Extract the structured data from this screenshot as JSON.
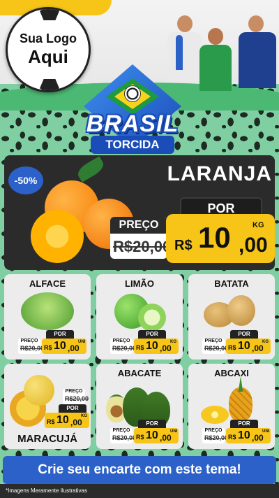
{
  "logo": {
    "line1": "Sua Logo",
    "line2": "Aqui"
  },
  "badge": {
    "title": "BRASIL",
    "subtitle": "TORCIDA"
  },
  "featured": {
    "name": "LARANJA",
    "discount": "-50%",
    "por_label": "POR",
    "preco_label": "PREÇO",
    "old_price": "R$20,00",
    "currency": "R$",
    "price_int": "10",
    "price_cents": ",00",
    "unit": "KG"
  },
  "items": [
    {
      "name": "ALFACE",
      "old_label": "PREÇO",
      "old_price": "R$20,00",
      "por": "POR",
      "currency": "R$",
      "price_int": "10",
      "price_cents": ",00",
      "unit": "UNI"
    },
    {
      "name": "LIMÃO",
      "old_label": "PREÇO",
      "old_price": "R$20,00",
      "por": "POR",
      "currency": "R$",
      "price_int": "10",
      "price_cents": ",00",
      "unit": "KG"
    },
    {
      "name": "BATATA",
      "old_label": "PREÇO",
      "old_price": "R$20,00",
      "por": "POR",
      "currency": "R$",
      "price_int": "10",
      "price_cents": ",00",
      "unit": "KG"
    },
    {
      "name": "MARACUJÁ",
      "old_label": "PREÇO",
      "old_price": "R$20,00",
      "por": "POR",
      "currency": "R$",
      "price_int": "10",
      "price_cents": ",00",
      "unit": "KG"
    },
    {
      "name": "ABACATE",
      "old_label": "PREÇO",
      "old_price": "R$20,00",
      "por": "POR",
      "currency": "R$",
      "price_int": "10",
      "price_cents": ",00",
      "unit": "UNI"
    },
    {
      "name": "ABCAXI",
      "old_label": "PREÇO",
      "old_price": "R$20,00",
      "por": "POR",
      "currency": "R$",
      "price_int": "10",
      "price_cents": ",00",
      "unit": "UNI"
    }
  ],
  "cta": "Crie seu encarte com este tema!",
  "disclaimer": "*Imagens Meramente Ilustrativas",
  "colors": {
    "accent_blue": "#2b61c9",
    "price_yellow": "#f6c518",
    "dark_panel": "#2b2b2b",
    "pattern_green": "#7fcfa3"
  }
}
